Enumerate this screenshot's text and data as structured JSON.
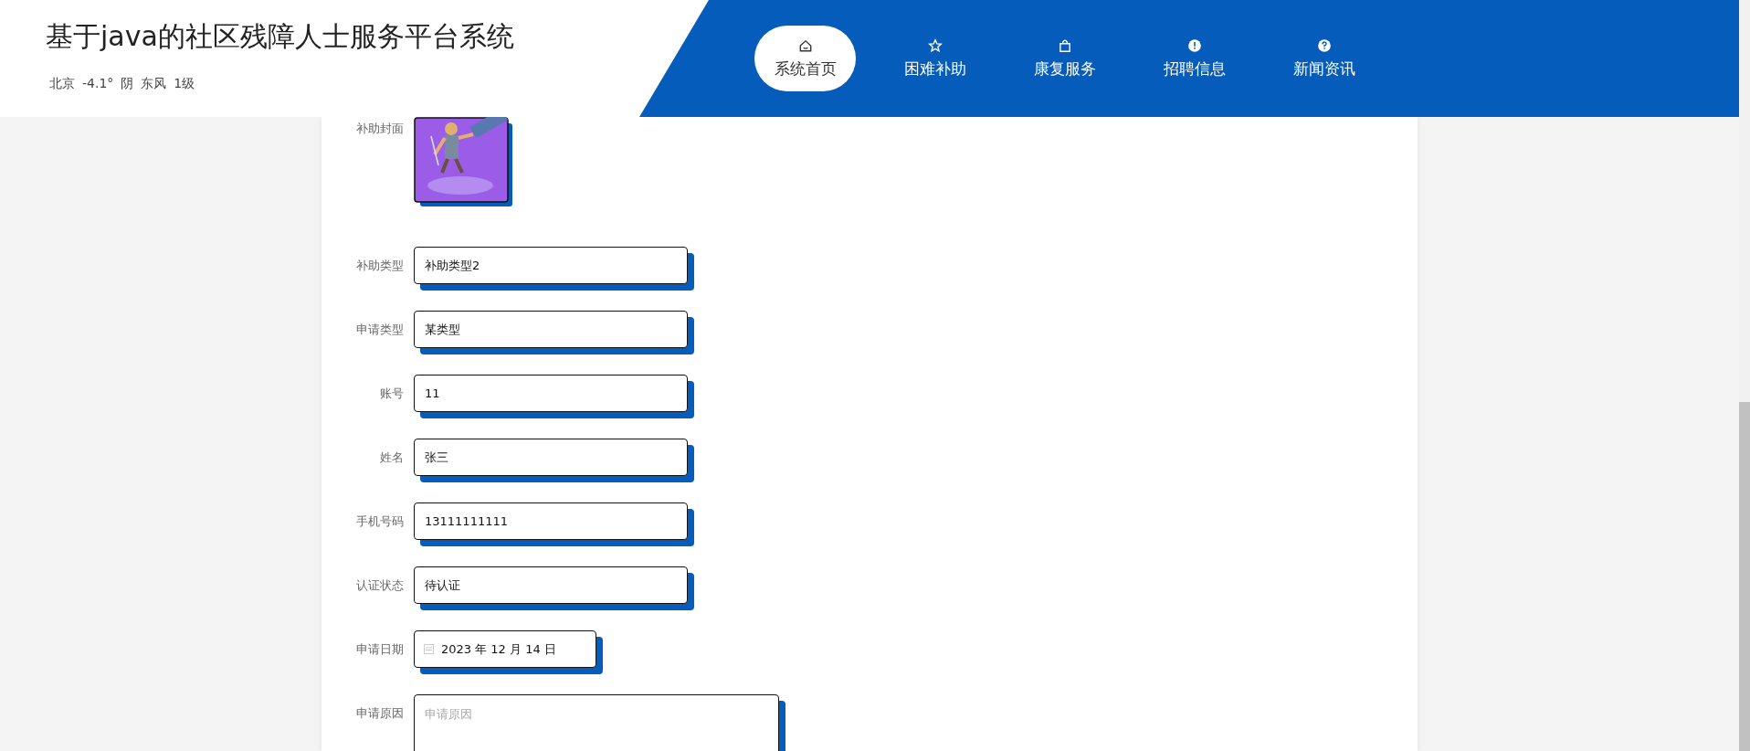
{
  "header": {
    "title": "基于java的社区残障人士服务平台系统",
    "weather": [
      "北京",
      "-4.1°",
      "阴",
      "东风",
      "1级"
    ]
  },
  "nav": [
    {
      "label": "系统首页",
      "kind": "house",
      "selected": true
    },
    {
      "label": "困难补助",
      "kind": "star",
      "selected": false
    },
    {
      "label": "康复服务",
      "kind": "bag",
      "selected": false
    },
    {
      "label": "招聘信息",
      "kind": "alert",
      "selected": false
    },
    {
      "label": "新闻资讯",
      "kind": "help",
      "selected": false
    }
  ],
  "form": [
    {
      "label": "补助封面"
    },
    {
      "kind": "text",
      "label": "补助类型",
      "value": "补助类型2"
    },
    {
      "kind": "text",
      "label": "申请类型",
      "value": "某类型"
    },
    {
      "kind": "text",
      "label": "账号",
      "value": "11"
    },
    {
      "kind": "text",
      "label": "姓名",
      "value": "张三"
    },
    {
      "kind": "text",
      "label": "手机号码",
      "value": "13111111111"
    },
    {
      "kind": "text",
      "label": "认证状态",
      "value": "待认证"
    },
    {
      "kind": "date",
      "label": "申请日期",
      "value": "2023 年 12 月 14 日"
    },
    {
      "kind": "textarea",
      "label": "申请原因",
      "placeholder": "申请原因"
    }
  ]
}
